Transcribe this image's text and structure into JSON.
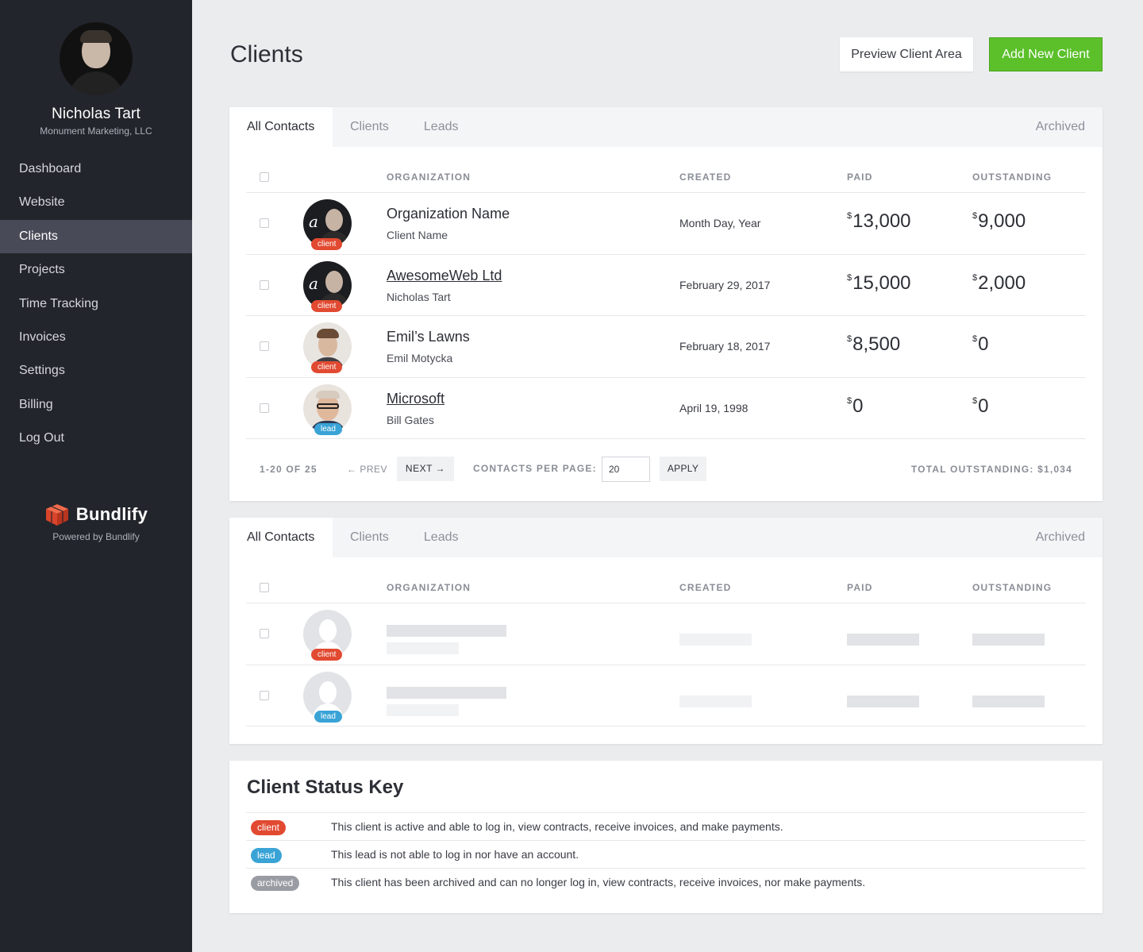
{
  "sidebar": {
    "user_name": "Nicholas Tart",
    "user_company": "Monument Marketing, LLC",
    "nav": [
      "Dashboard",
      "Website",
      "Clients",
      "Projects",
      "Time Tracking",
      "Invoices",
      "Settings",
      "Billing",
      "Log Out"
    ],
    "active_nav": "Clients",
    "brand_name": "Bundlify",
    "brand_sub": "Powered by Bundlify"
  },
  "header": {
    "title": "Clients",
    "preview_label": "Preview Client Area",
    "add_label": "Add New Client"
  },
  "tabs": [
    "All Contacts",
    "Clients",
    "Leads"
  ],
  "archived_tab": "Archived",
  "columns": {
    "organization": "ORGANIZATION",
    "created": "CREATED",
    "paid": "PAID",
    "outstanding": "OUTSTANDING"
  },
  "currency": "$",
  "rows": [
    {
      "organization": "Organization Name",
      "client_name": "Client Name",
      "created": "Month Day, Year",
      "paid": "13,000",
      "outstanding": "9,000",
      "status": "client",
      "avatar_letter": "a"
    },
    {
      "organization": "AwesomeWeb Ltd",
      "client_name": "Nicholas Tart",
      "created": "February 29, 2017",
      "paid": "15,000",
      "outstanding": "2,000",
      "status": "client",
      "avatar_letter": "a"
    },
    {
      "organization": "Emil’s Lawns",
      "client_name": "Emil Motycka",
      "created": "February 18, 2017",
      "paid": "8,500",
      "outstanding": "0",
      "status": "client"
    },
    {
      "organization": "Microsoft",
      "client_name": "Bill Gates",
      "created": "April 19, 1998",
      "paid": "0",
      "outstanding": "0",
      "status": "lead"
    }
  ],
  "pager": {
    "count": "1-20 OF 25",
    "prev": "PREV",
    "next": "NEXT",
    "per_page_label": "CONTACTS PER PAGE:",
    "per_page_value": "20",
    "apply": "APPLY",
    "total_outstanding": "TOTAL OUTSTANDING: $1,034"
  },
  "placeholder_rows": [
    {
      "status": "client"
    },
    {
      "status": "lead"
    }
  ],
  "status_key": {
    "title": "Client Status Key",
    "items": [
      {
        "badge": "client",
        "text": "This client is active and able to log in, view contracts, receive invoices, and make payments."
      },
      {
        "badge": "lead",
        "text": "This lead is not able to log in nor have an account."
      },
      {
        "badge": "archived",
        "text": "This client has been archived and can no longer log in, view contracts, receive invoices, nor make payments."
      }
    ]
  },
  "colors": {
    "sidebar_bg": "#23252c",
    "accent_green": "#5bc02a",
    "client_badge": "#e14a31",
    "lead_badge": "#3aa3d6",
    "archived_badge": "#9a9ca3"
  }
}
